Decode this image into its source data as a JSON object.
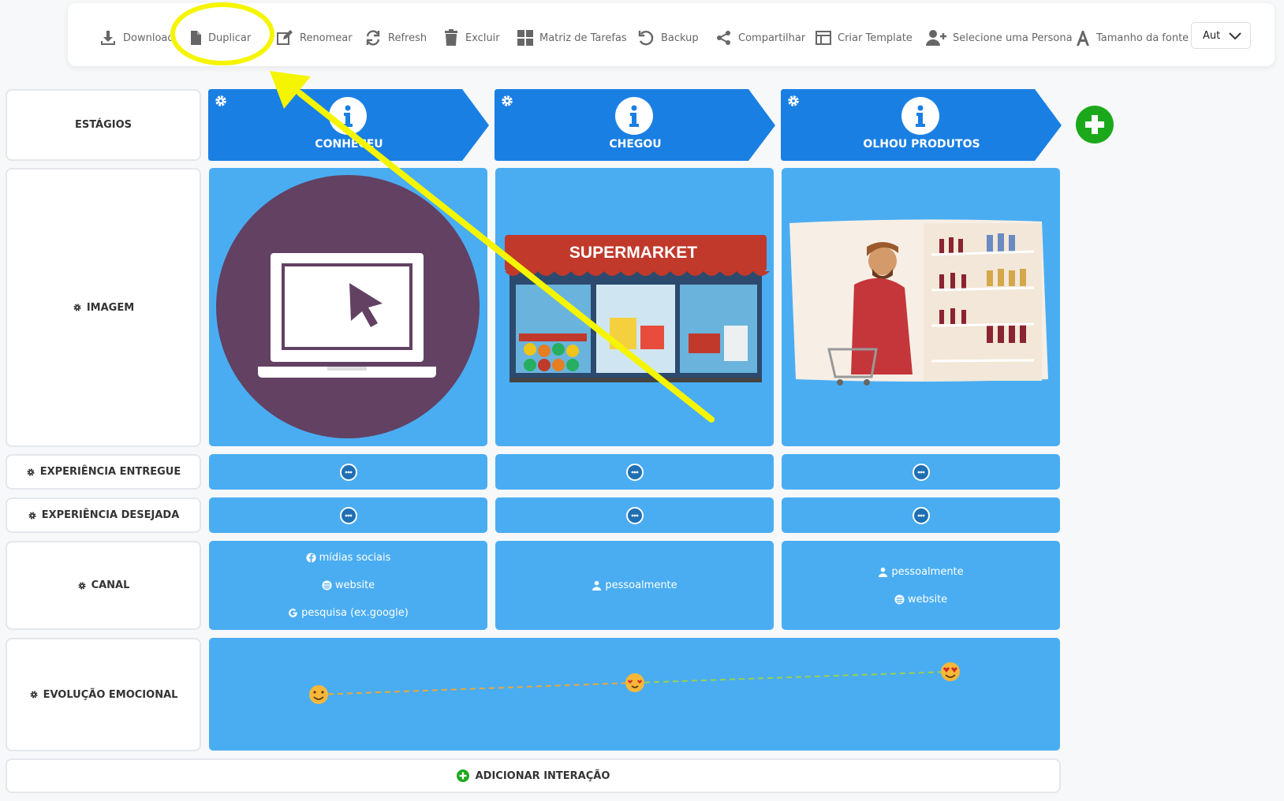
{
  "toolbar": {
    "download": "Download",
    "duplicate": "Duplicar",
    "rename": "Renomear",
    "refresh": "Refresh",
    "delete": "Excluir",
    "task_matrix": "Matriz de Tarefas",
    "backup": "Backup",
    "share": "Compartilhar",
    "create_template": "Criar Template",
    "select_persona": "Selecione uma Persona",
    "font_size": "Tamanho da fonte",
    "font_select_value": "Aut"
  },
  "rows": {
    "stages": "ESTÁGIOS",
    "image": "IMAGEM",
    "delivered": "EXPERIÊNCIA ENTREGUE",
    "desired": "EXPERIÊNCIA DESEJADA",
    "channel": "CANAL",
    "emotion": "EVOLUÇÃO EMOCIONAL"
  },
  "stages": [
    "CONHECEU",
    "CHEGOU",
    "OLHOU PRODUTOS"
  ],
  "image_text": {
    "store_sign": "SUPERMARKET"
  },
  "channels": {
    "col1": [
      "mídias sociais",
      "website",
      "pesquisa (ex.google)"
    ],
    "col2": [
      "pessoalmente"
    ],
    "col3": [
      "pessoalmente",
      "website"
    ]
  },
  "emotion_points": [
    "happy",
    "loving",
    "heart-eyes"
  ],
  "add_interaction": "ADICIONAR INTERAÇÃO",
  "colors": {
    "stage_header": "#1a7fe3",
    "cell": "#4aadf2",
    "add": "#1ba91b",
    "highlight": "#f5f500"
  }
}
